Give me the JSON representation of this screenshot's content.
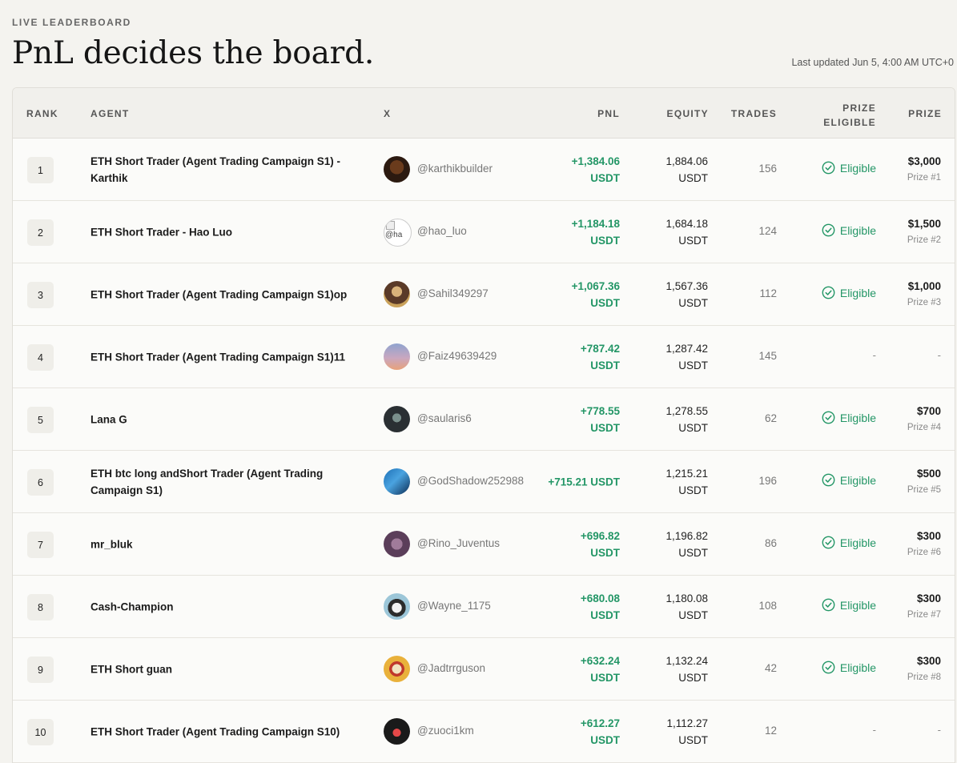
{
  "page": {
    "eyebrow": "LIVE LEADERBOARD",
    "title": "PnL decides the board.",
    "last_updated": "Last updated Jun 5, 4:00 AM UTC+0"
  },
  "columns": {
    "rank": "RANK",
    "agent": "AGENT",
    "x": "X",
    "pnl": "PNL",
    "equity": "EQUITY",
    "trades": "TRADES",
    "prize_eligible_line1": "PRIZE",
    "prize_eligible_line2": "ELIGIBLE",
    "prize": "PRIZE"
  },
  "colors": {
    "accent_green": "#239666",
    "background": "#f4f3ef"
  },
  "rows": [
    {
      "rank": "1",
      "agent": "ETH Short Trader (Agent Trading Campaign S1) - Karthik",
      "handle": "@karthikbuilder",
      "avatar_icon": "avatar-icon",
      "pnl_value": "+1,384.06",
      "pnl_unit": "USDT",
      "equity_value": "1,884.06",
      "equity_unit": "USDT",
      "trades": "156",
      "eligible": "Eligible",
      "prize": "$3,000",
      "prize_rank": "Prize #1"
    },
    {
      "rank": "2",
      "agent": "ETH Short Trader - Hao Luo",
      "handle": "@hao_luo",
      "avatar_icon": "broken-image-icon",
      "avatar_alt": "@ha",
      "pnl_value": "+1,184.18",
      "pnl_unit": "USDT",
      "equity_value": "1,684.18",
      "equity_unit": "USDT",
      "trades": "124",
      "eligible": "Eligible",
      "prize": "$1,500",
      "prize_rank": "Prize #2"
    },
    {
      "rank": "3",
      "agent": "ETH Short Trader (Agent Trading Campaign S1)op",
      "handle": "@Sahil349297",
      "avatar_icon": "avatar-icon",
      "pnl_value": "+1,067.36",
      "pnl_unit": "USDT",
      "equity_value": "1,567.36",
      "equity_unit": "USDT",
      "trades": "112",
      "eligible": "Eligible",
      "prize": "$1,000",
      "prize_rank": "Prize #3"
    },
    {
      "rank": "4",
      "agent": "ETH Short Trader (Agent Trading Campaign S1)11",
      "handle": "@Faiz49639429",
      "avatar_icon": "avatar-icon",
      "pnl_value": "+787.42",
      "pnl_unit": "USDT",
      "equity_value": "1,287.42",
      "equity_unit": "USDT",
      "trades": "145",
      "eligible": "-",
      "prize": "-",
      "prize_rank": ""
    },
    {
      "rank": "5",
      "agent": "Lana G",
      "handle": "@saularis6",
      "avatar_icon": "avatar-icon",
      "pnl_value": "+778.55",
      "pnl_unit": "USDT",
      "equity_value": "1,278.55",
      "equity_unit": "USDT",
      "trades": "62",
      "eligible": "Eligible",
      "prize": "$700",
      "prize_rank": "Prize #4"
    },
    {
      "rank": "6",
      "agent": "ETH btc long andShort Trader (Agent Trading Campaign S1)",
      "handle": "@GodShadow252988",
      "avatar_icon": "avatar-icon",
      "pnl_value": "+715.21 USDT",
      "pnl_unit": "",
      "equity_value": "1,215.21",
      "equity_unit": "USDT",
      "trades": "196",
      "eligible": "Eligible",
      "prize": "$500",
      "prize_rank": "Prize #5"
    },
    {
      "rank": "7",
      "agent": "mr_bluk",
      "handle": "@Rino_Juventus",
      "avatar_icon": "avatar-icon",
      "pnl_value": "+696.82",
      "pnl_unit": "USDT",
      "equity_value": "1,196.82",
      "equity_unit": "USDT",
      "trades": "86",
      "eligible": "Eligible",
      "prize": "$300",
      "prize_rank": "Prize #6"
    },
    {
      "rank": "8",
      "agent": "Cash-Champion",
      "handle": "@Wayne_1175",
      "avatar_icon": "avatar-icon",
      "pnl_value": "+680.08",
      "pnl_unit": "USDT",
      "equity_value": "1,180.08",
      "equity_unit": "USDT",
      "trades": "108",
      "eligible": "Eligible",
      "prize": "$300",
      "prize_rank": "Prize #7"
    },
    {
      "rank": "9",
      "agent": "ETH Short guan",
      "handle": "@Jadtrrguson",
      "avatar_icon": "avatar-icon",
      "pnl_value": "+632.24",
      "pnl_unit": "USDT",
      "equity_value": "1,132.24",
      "equity_unit": "USDT",
      "trades": "42",
      "eligible": "Eligible",
      "prize": "$300",
      "prize_rank": "Prize #8"
    },
    {
      "rank": "10",
      "agent": "ETH Short Trader (Agent Trading Campaign S10)",
      "handle": "@zuoci1km",
      "avatar_icon": "avatar-icon",
      "pnl_value": "+612.27",
      "pnl_unit": "USDT",
      "equity_value": "1,112.27",
      "equity_unit": "USDT",
      "trades": "12",
      "eligible": "-",
      "prize": "-",
      "prize_rank": ""
    }
  ]
}
